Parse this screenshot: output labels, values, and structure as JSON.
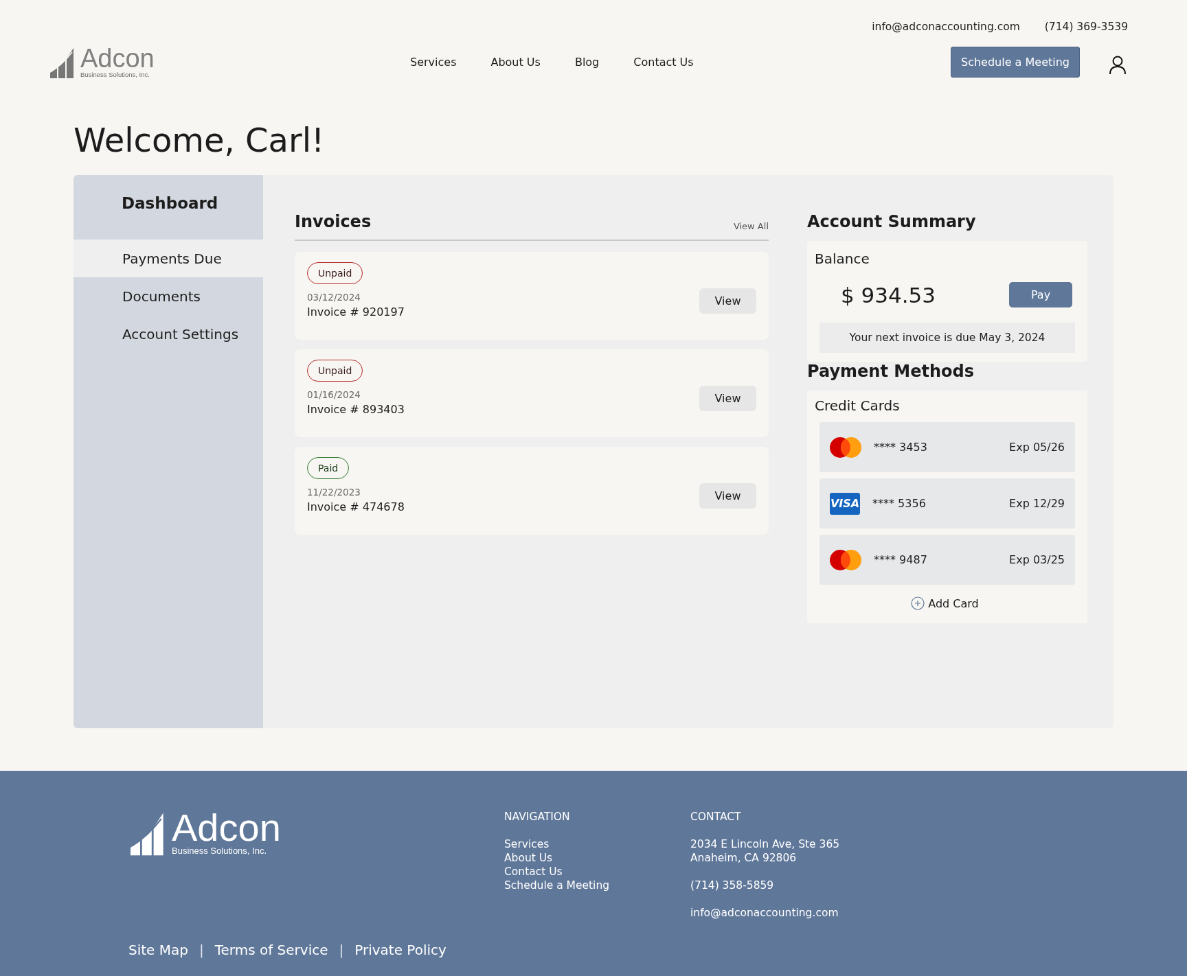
{
  "header": {
    "email": "info@adconaccounting.com",
    "phone": "(714) 369-3539",
    "logo": {
      "name": "Adcon",
      "tagline": "Business Solutions, Inc."
    },
    "nav": [
      "Services",
      "About Us",
      "Blog",
      "Contact Us"
    ],
    "cta": "Schedule a Meeting"
  },
  "welcome": "Welcome, Carl!",
  "sidebar": {
    "title": "Dashboard",
    "items": [
      {
        "label": "Payments Due",
        "selected": true
      },
      {
        "label": "Documents",
        "selected": false
      },
      {
        "label": "Account Settings",
        "selected": false
      }
    ]
  },
  "invoices": {
    "title": "Invoices",
    "view_all": "View All",
    "items": [
      {
        "kind": "unpaid",
        "status": "Unpaid",
        "date": "03/12/2024",
        "number": "Invoice # 920197",
        "action": "View"
      },
      {
        "kind": "unpaid",
        "status": "Unpaid",
        "date": "01/16/2024",
        "number": "Invoice # 893403",
        "action": "View"
      },
      {
        "kind": "paid",
        "status": "Paid",
        "date": "11/22/2023",
        "number": "Invoice # 474678",
        "action": "View"
      }
    ]
  },
  "account_summary": {
    "title": "Account Summary",
    "balance_label": "Balance",
    "balance": "$ 934.53",
    "pay": "Pay",
    "note": "Your next invoice is due May 3, 2024"
  },
  "payment_methods": {
    "title": "Payment Methods",
    "section": "Credit Cards",
    "cards": [
      {
        "kind": "mastercard",
        "number": "**** 3453",
        "exp": "Exp 05/26"
      },
      {
        "kind": "visa",
        "logo_text": "VISA",
        "number": "**** 5356",
        "exp": "Exp 12/29"
      },
      {
        "kind": "mastercard",
        "number": "**** 9487",
        "exp": "Exp 03/25"
      }
    ],
    "add_card": "Add Card"
  },
  "footer": {
    "logo": {
      "name": "Adcon",
      "tagline": "Business Solutions, Inc."
    },
    "navigation": {
      "title": "NAVIGATION",
      "links": [
        "Services",
        "About Us",
        "Contact Us",
        "Schedule a Meeting"
      ]
    },
    "contact": {
      "title": "CONTACT",
      "address": [
        "2034 E Lincoln Ave, Ste 365",
        "Anaheim, CA 92806"
      ],
      "phone": "(714) 358-5859",
      "email": "info@adconaccounting.com"
    },
    "bottom": [
      {
        "kind": "link",
        "text": "Site Map"
      },
      {
        "kind": "separator",
        "text": "|"
      },
      {
        "kind": "link",
        "text": "Terms of Service"
      },
      {
        "kind": "separator",
        "text": "|"
      },
      {
        "kind": "link",
        "text": "Private Policy"
      }
    ]
  }
}
